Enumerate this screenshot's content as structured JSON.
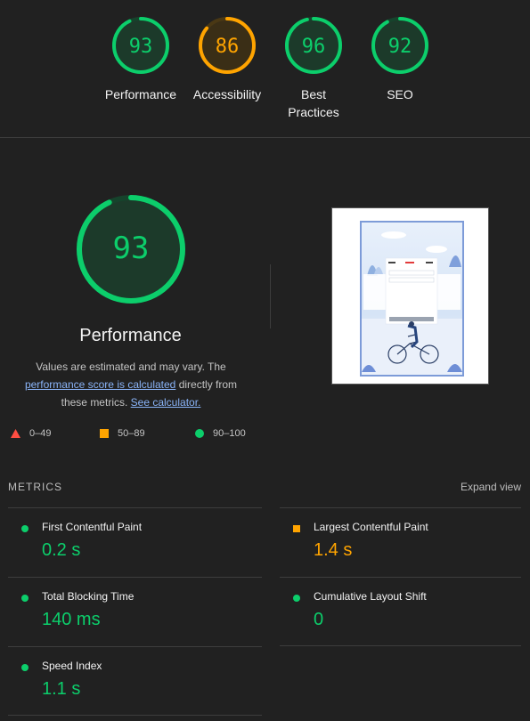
{
  "colors": {
    "pass": "#0cce6b",
    "average": "#ffa400",
    "fail": "#ff4e42"
  },
  "gauges": [
    {
      "score": "93",
      "label": "Performance",
      "fraction": 0.93,
      "status": "pass"
    },
    {
      "score": "86",
      "label": "Accessibility",
      "fraction": 0.86,
      "status": "average"
    },
    {
      "score": "96",
      "label": "Best Practices",
      "fraction": 0.96,
      "status": "pass"
    },
    {
      "score": "92",
      "label": "SEO",
      "fraction": 0.92,
      "status": "pass"
    }
  ],
  "performance": {
    "score": "93",
    "fraction": 0.93,
    "title": "Performance",
    "desc_pre": "Values are estimated and may vary. The ",
    "desc_link": "performance score is calculated",
    "desc_mid": " directly from these metrics. ",
    "calc_link": "See calculator."
  },
  "legend": [
    {
      "range": "0–49",
      "icon": "triangle-icon"
    },
    {
      "range": "50–89",
      "icon": "square-icon"
    },
    {
      "range": "90–100",
      "icon": "circle-icon"
    }
  ],
  "metrics": {
    "header": "METRICS",
    "expand": "Expand view",
    "items": [
      {
        "title": "First Contentful Paint",
        "value": "0.2 s",
        "status": "pass"
      },
      {
        "title": "Largest Contentful Paint",
        "value": "1.4 s",
        "status": "average"
      },
      {
        "title": "Total Blocking Time",
        "value": "140 ms",
        "status": "pass"
      },
      {
        "title": "Cumulative Layout Shift",
        "value": "0",
        "status": "pass"
      },
      {
        "title": "Speed Index",
        "value": "1.1 s",
        "status": "pass"
      }
    ]
  }
}
